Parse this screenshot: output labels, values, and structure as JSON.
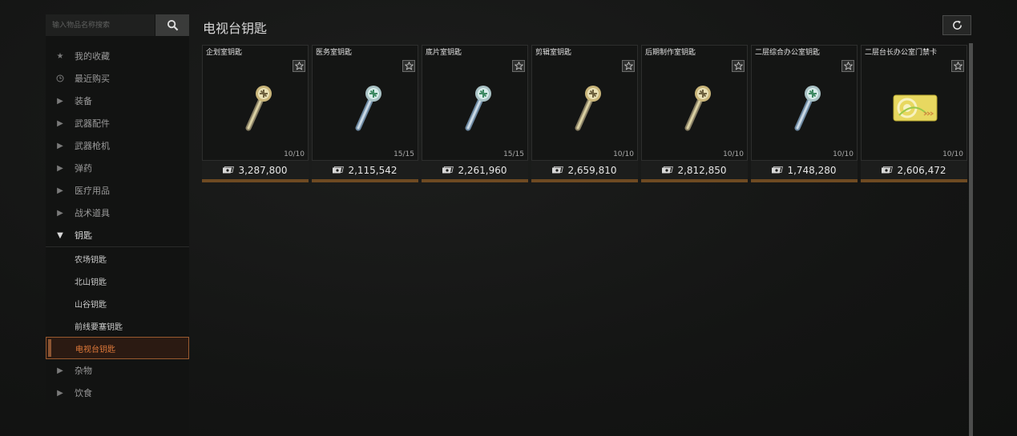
{
  "search": {
    "placeholder": "输入物品名称搜索"
  },
  "page_title": "电视台钥匙",
  "nav": {
    "favorites": "我的收藏",
    "recent": "最近购买",
    "categories": [
      "装备",
      "武器配件",
      "武器枪机",
      "弹药",
      "医疗用品",
      "战术道具"
    ],
    "open_category": "钥匙",
    "sub_items": [
      "农场钥匙",
      "北山钥匙",
      "山谷钥匙",
      "前线要塞钥匙"
    ],
    "active_sub_item": "电视台钥匙",
    "bottom_categories": [
      "杂物",
      "饮食"
    ]
  },
  "items": [
    {
      "name": "企划室钥匙",
      "durability": "10/10",
      "price": "3,287,800",
      "icon": "gold-key"
    },
    {
      "name": "医务室钥匙",
      "durability": "15/15",
      "price": "2,115,542",
      "icon": "silver-key"
    },
    {
      "name": "底片室钥匙",
      "durability": "15/15",
      "price": "2,261,960",
      "icon": "silver-key"
    },
    {
      "name": "剪辑室钥匙",
      "durability": "10/10",
      "price": "2,659,810",
      "icon": "gold-key"
    },
    {
      "name": "后期制作室钥匙",
      "durability": "10/10",
      "price": "2,812,850",
      "icon": "gold-key"
    },
    {
      "name": "二层综合办公室钥匙",
      "durability": "10/10",
      "price": "1,748,280",
      "icon": "silver-key"
    },
    {
      "name": "二层台长办公室门禁卡",
      "durability": "10/10",
      "price": "2,606,472",
      "icon": "access-card"
    }
  ],
  "colors": {
    "accent": "#e07a3a",
    "card_bar": "#6e4a22"
  }
}
